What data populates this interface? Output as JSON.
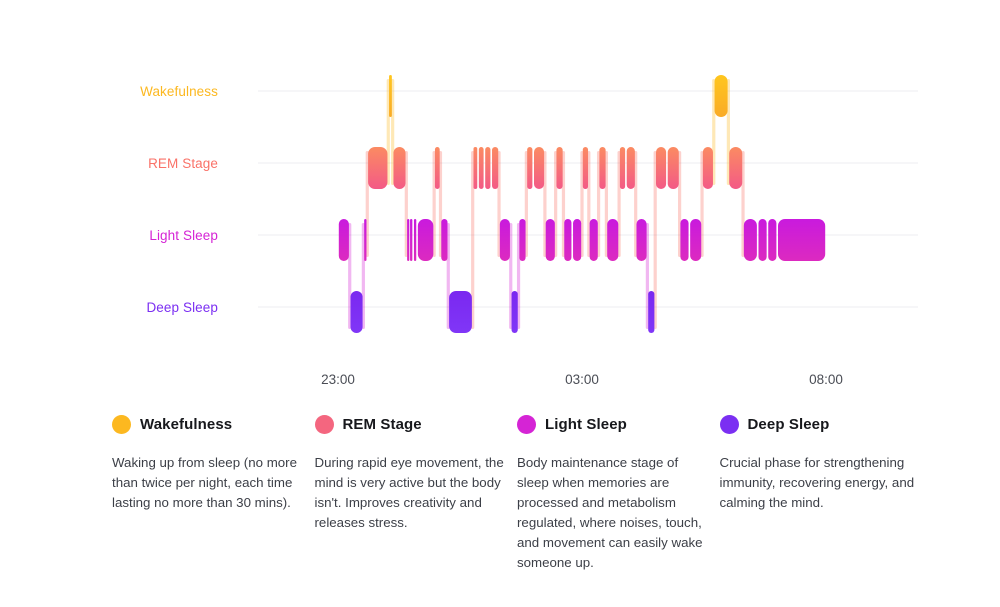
{
  "chart_data": {
    "type": "area",
    "title": "",
    "xlabel": "",
    "ylabel": "",
    "grid": true,
    "legend_position": "bottom",
    "stages": [
      {
        "key": "wakefulness",
        "label": "Wakefulness",
        "level": 3,
        "color": "#fcb820",
        "color_top": "#ffc61e",
        "color_bottom": "#f9ad24"
      },
      {
        "key": "rem",
        "label": "REM Stage",
        "level": 2,
        "color": "#fa7268",
        "color_top": "#fb8268",
        "color_bottom": "#f4607f"
      },
      {
        "key": "light",
        "label": "Light Sleep",
        "level": 1,
        "color": "#d524d5",
        "color_top": "#cc1fd8",
        "color_bottom": "#d826c6"
      },
      {
        "key": "deep",
        "label": "Deep Sleep",
        "level": 0,
        "color": "#7b2ff2",
        "color_top": "#7a2bf0",
        "color_bottom": "#7f33f5"
      }
    ],
    "x_axis": {
      "tick_labels": [
        "23:00",
        "03:00",
        "08:00"
      ],
      "tick_positions_pct": [
        0.0,
        50.0,
        100.0
      ],
      "domain_start": "23:00",
      "domain_end": "08:00"
    },
    "y_axis": {
      "categories": [
        "Wakefulness",
        "REM Stage",
        "Light Sleep",
        "Deep Sleep"
      ],
      "order_top_to_bottom": [
        "Wakefulness",
        "REM Stage",
        "Light Sleep",
        "Deep Sleep"
      ]
    },
    "segments": [
      {
        "start": 0.0,
        "end": 2.4,
        "stage": "light"
      },
      {
        "start": 2.4,
        "end": 5.2,
        "stage": "deep"
      },
      {
        "start": 5.2,
        "end": 6.0,
        "stage": "light"
      },
      {
        "start": 6.0,
        "end": 10.3,
        "stage": "rem"
      },
      {
        "start": 10.3,
        "end": 11.2,
        "stage": "wakefulness"
      },
      {
        "start": 11.2,
        "end": 14.0,
        "stage": "rem"
      },
      {
        "start": 14.0,
        "end": 14.6,
        "stage": "light"
      },
      {
        "start": 14.6,
        "end": 15.4,
        "stage": "light"
      },
      {
        "start": 15.4,
        "end": 16.2,
        "stage": "light"
      },
      {
        "start": 16.2,
        "end": 19.7,
        "stage": "light"
      },
      {
        "start": 19.7,
        "end": 21.0,
        "stage": "rem"
      },
      {
        "start": 21.0,
        "end": 22.6,
        "stage": "light"
      },
      {
        "start": 22.6,
        "end": 27.6,
        "stage": "deep"
      },
      {
        "start": 27.6,
        "end": 28.7,
        "stage": "rem"
      },
      {
        "start": 28.7,
        "end": 30.0,
        "stage": "rem"
      },
      {
        "start": 30.0,
        "end": 31.4,
        "stage": "rem"
      },
      {
        "start": 31.4,
        "end": 33.0,
        "stage": "rem"
      },
      {
        "start": 33.0,
        "end": 35.4,
        "stage": "light"
      },
      {
        "start": 35.4,
        "end": 37.0,
        "stage": "deep"
      },
      {
        "start": 37.0,
        "end": 38.6,
        "stage": "light"
      },
      {
        "start": 38.6,
        "end": 40.0,
        "stage": "rem"
      },
      {
        "start": 40.0,
        "end": 42.4,
        "stage": "rem"
      },
      {
        "start": 42.4,
        "end": 44.6,
        "stage": "light"
      },
      {
        "start": 44.6,
        "end": 46.2,
        "stage": "rem"
      },
      {
        "start": 46.2,
        "end": 48.0,
        "stage": "light"
      },
      {
        "start": 48.0,
        "end": 50.0,
        "stage": "light"
      },
      {
        "start": 50.0,
        "end": 51.4,
        "stage": "rem"
      },
      {
        "start": 51.4,
        "end": 53.4,
        "stage": "light"
      },
      {
        "start": 53.4,
        "end": 55.0,
        "stage": "rem"
      },
      {
        "start": 55.0,
        "end": 57.6,
        "stage": "light"
      },
      {
        "start": 57.6,
        "end": 59.0,
        "stage": "rem"
      },
      {
        "start": 59.0,
        "end": 61.0,
        "stage": "rem"
      },
      {
        "start": 61.0,
        "end": 63.4,
        "stage": "light"
      },
      {
        "start": 63.4,
        "end": 65.0,
        "stage": "deep"
      },
      {
        "start": 65.0,
        "end": 67.4,
        "stage": "rem"
      },
      {
        "start": 67.4,
        "end": 70.0,
        "stage": "rem"
      },
      {
        "start": 70.0,
        "end": 72.0,
        "stage": "light"
      },
      {
        "start": 72.0,
        "end": 74.6,
        "stage": "light"
      },
      {
        "start": 74.6,
        "end": 77.0,
        "stage": "rem"
      },
      {
        "start": 77.0,
        "end": 80.0,
        "stage": "wakefulness"
      },
      {
        "start": 80.0,
        "end": 83.0,
        "stage": "rem"
      },
      {
        "start": 83.0,
        "end": 86.0,
        "stage": "light"
      },
      {
        "start": 86.0,
        "end": 88.0,
        "stage": "light"
      },
      {
        "start": 88.0,
        "end": 90.0,
        "stage": "light"
      },
      {
        "start": 90.0,
        "end": 100.0,
        "stage": "light"
      }
    ]
  },
  "legend": {
    "items": [
      {
        "label": "Wakefulness",
        "color": "#fcb820",
        "description": "Waking up from sleep (no more than twice per night, each time lasting no more than 30 mins)."
      },
      {
        "label": "REM Stage",
        "color": "#f4667f",
        "description": "During rapid eye movement, the mind is very active but the body isn't. Improves creativity and releases stress."
      },
      {
        "label": "Light Sleep",
        "color": "#d524d5",
        "description": "Body maintenance stage of sleep when memories are processed and metabolism regulated, where noises, touch, and movement can easily wake someone up."
      },
      {
        "label": "Deep Sleep",
        "color": "#7b2ff2",
        "description": "Crucial phase for strengthening immunity, recovering energy, and calming the mind."
      }
    ]
  }
}
